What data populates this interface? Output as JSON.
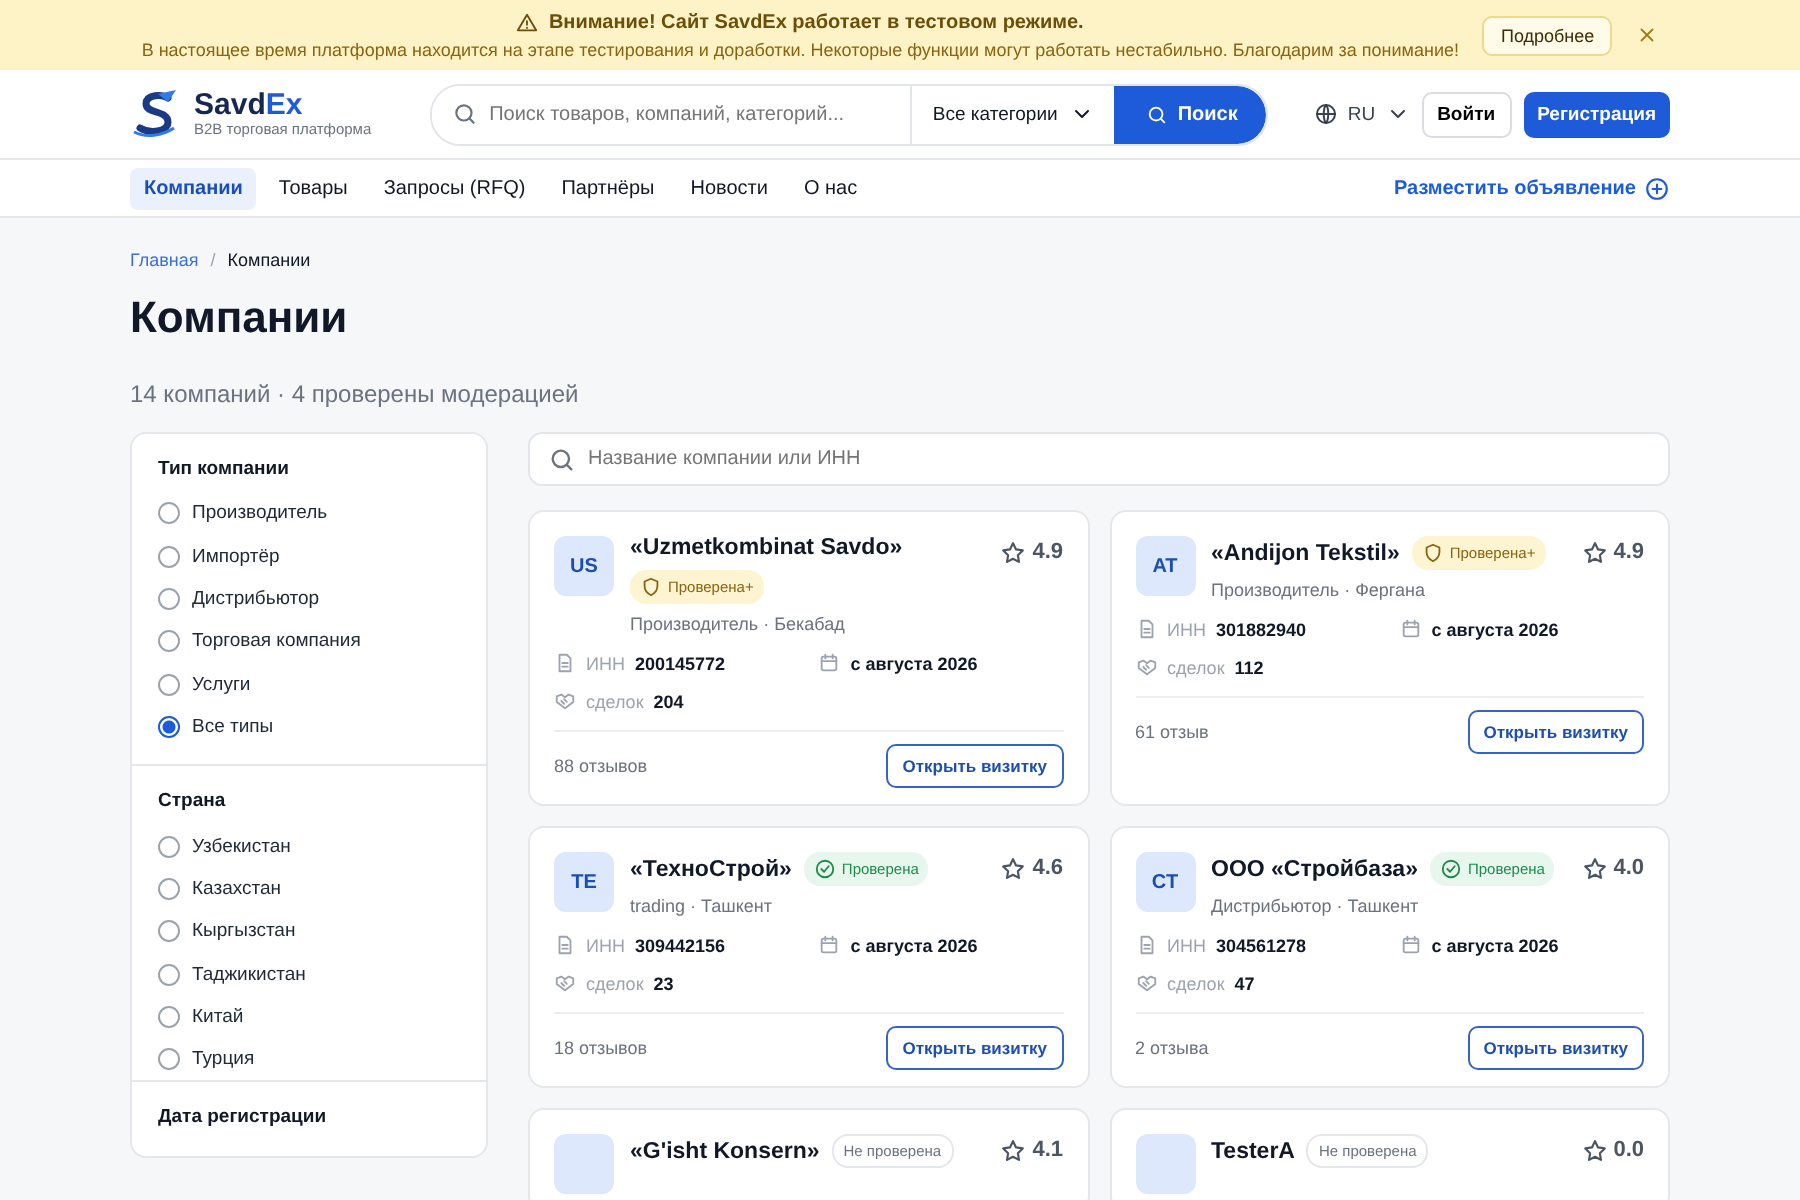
{
  "banner": {
    "title": "Внимание! Сайт SavdEx работает в тестовом режиме.",
    "message": "В настоящее время платформа находится на этапе тестирования и доработки. Некоторые функции могут работать нестабильно. Благодарим за понимание!",
    "more_button": "Подробнее"
  },
  "header": {
    "brand": "Savd",
    "brand_accent": "Ex",
    "tagline": "B2B торговая платформа",
    "search_placeholder": "Поиск товаров, компаний, категорий...",
    "category": "Все категории",
    "search_button": "Поиск",
    "language": "RU",
    "login": "Войти",
    "register": "Регистрация"
  },
  "nav": {
    "items": [
      {
        "label": "Компании",
        "selected": true
      },
      {
        "label": "Товары",
        "selected": false
      },
      {
        "label": "Запросы (RFQ)",
        "selected": false
      },
      {
        "label": "Партнёры",
        "selected": false
      },
      {
        "label": "Новости",
        "selected": false
      },
      {
        "label": "О нас",
        "selected": false
      }
    ],
    "post_link": "Разместить объявление"
  },
  "breadcrumbs": {
    "items": [
      "Главная",
      "Компании"
    ],
    "separator": "/"
  },
  "page_title": "Компании",
  "summary": "14 компаний · 4 проверены модерацией",
  "filters": [
    {
      "title": "Тип компании",
      "options": [
        {
          "label": "Производитель",
          "selected": false
        },
        {
          "label": "Импортёр",
          "selected": false
        },
        {
          "label": "Дистрибьютор",
          "selected": false
        },
        {
          "label": "Торговая компания",
          "selected": false
        },
        {
          "label": "Услуги",
          "selected": false
        },
        {
          "label": "Все типы",
          "selected": true
        }
      ]
    },
    {
      "title": "Страна",
      "options": [
        {
          "label": "Узбекистан",
          "selected": false
        },
        {
          "label": "Казахстан",
          "selected": false
        },
        {
          "label": "Кыргызстан",
          "selected": false
        },
        {
          "label": "Таджикистан",
          "selected": false
        },
        {
          "label": "Китай",
          "selected": false
        },
        {
          "label": "Турция",
          "selected": false
        }
      ]
    },
    {
      "title": "Дата регистрации"
    }
  ],
  "company_search_placeholder": "Название компании или ИНН",
  "companies": [
    {
      "initials": "US",
      "name": "«Uzmetkombinat Savdo»",
      "badge": {
        "kind": "plus",
        "label": "Проверена+"
      },
      "rating": "4.9",
      "meta": "Производитель · Бекабад",
      "inn_label": "ИНН",
      "inn": "200145772",
      "since": "с августа 2026",
      "deals_label": "сделок",
      "deals": "204",
      "reviews": "88 отзывов",
      "open_button": "Открыть визитку"
    },
    {
      "initials": "AT",
      "name": "«Andijon Tekstil»",
      "badge": {
        "kind": "plus",
        "label": "Проверена+"
      },
      "rating": "4.9",
      "meta": "Производитель · Фергана",
      "inn_label": "ИНН",
      "inn": "301882940",
      "since": "с августа 2026",
      "deals_label": "сделок",
      "deals": "112",
      "reviews": "61 отзыв",
      "open_button": "Открыть визитку"
    },
    {
      "initials": "TE",
      "name": "«ТехноСтрой»",
      "badge": {
        "kind": "verified",
        "label": "Проверена"
      },
      "rating": "4.6",
      "meta": "trading · Ташкент",
      "inn_label": "ИНН",
      "inn": "309442156",
      "since": "с августа 2026",
      "deals_label": "сделок",
      "deals": "23",
      "reviews": "18 отзывов",
      "open_button": "Открыть визитку"
    },
    {
      "initials": "CT",
      "name": "ООО «Стройбаза»",
      "badge": {
        "kind": "verified",
        "label": "Проверена"
      },
      "rating": "4.0",
      "meta": "Дистрибьютор · Ташкент",
      "inn_label": "ИНН",
      "inn": "304561278",
      "since": "с августа 2026",
      "deals_label": "сделок",
      "deals": "47",
      "reviews": "2 отзыва",
      "open_button": "Открыть визитку"
    },
    {
      "name": "«G'isht Konsern»",
      "badge": {
        "kind": "unverified",
        "label": "Не проверена"
      },
      "rating": "4.1"
    },
    {
      "name": "TesterA",
      "badge": {
        "kind": "unverified",
        "label": "Не проверена"
      },
      "rating": "0.0"
    }
  ]
}
